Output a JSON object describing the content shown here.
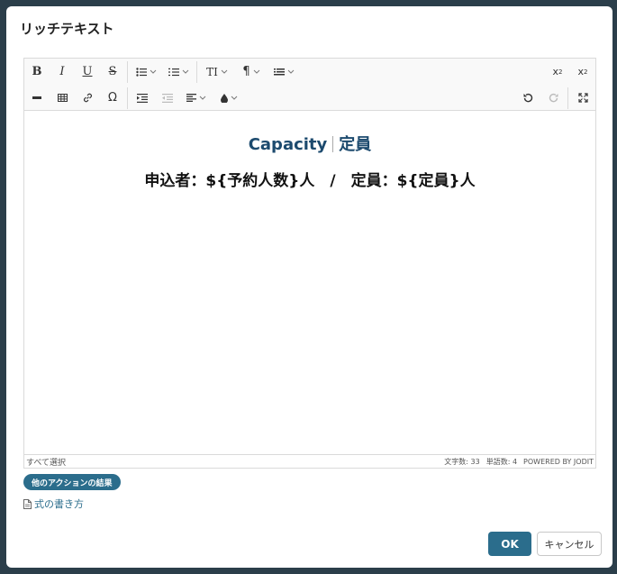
{
  "dialog": {
    "title": "リッチテキスト"
  },
  "toolbar": {
    "bold": "B",
    "italic": "I",
    "underline": "U",
    "strikethrough": "S",
    "paragraph": "¶",
    "superscript_base": "x",
    "superscript_mark": "2",
    "subscript_base": "x",
    "subscript_mark": "2",
    "font_size": "TI",
    "special_char": "Ω"
  },
  "content": {
    "line1_en": "Capacity",
    "line1_ja": "定員",
    "line2": "申込者：${予約人数}人　/　定員：${定員}人"
  },
  "statusbar": {
    "select_all": "すべて選択",
    "char_count": "文字数: 33",
    "word_count": "単語数: 4",
    "powered_by": "POWERED BY JODIT"
  },
  "badge": {
    "label": "他のアクションの結果"
  },
  "help_link": {
    "label": "式の書き方"
  },
  "buttons": {
    "ok": "OK",
    "cancel": "キャンセル"
  },
  "colors": {
    "accent": "#2b6d8c",
    "heading": "#1c4a6e",
    "backdrop": "#2b3e4a"
  }
}
